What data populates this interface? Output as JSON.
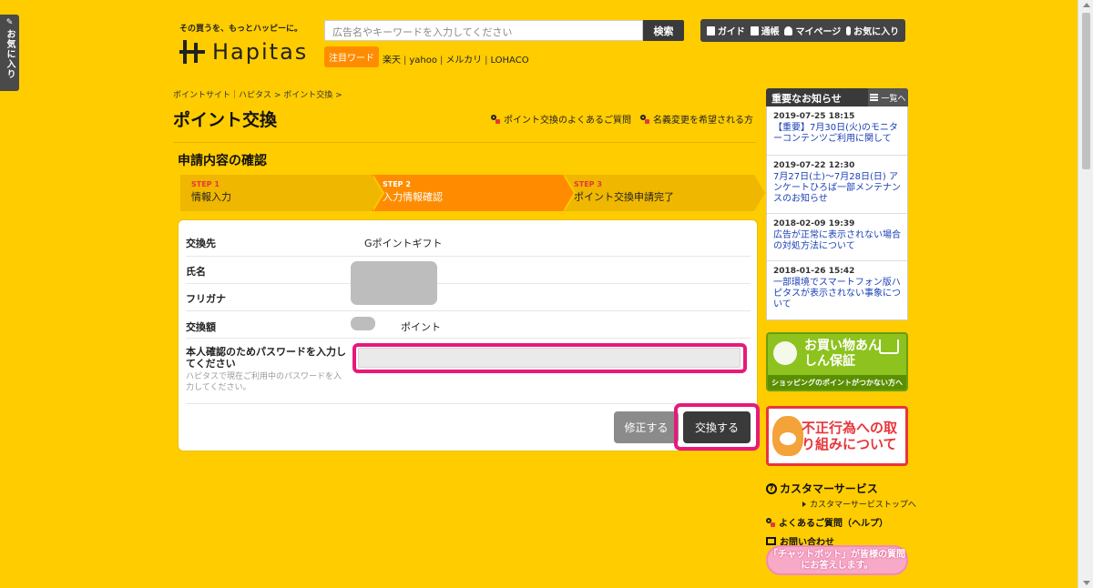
{
  "side_tab": {
    "label": "お気に入り"
  },
  "header": {
    "tagline": "その買うを、もっとハッピーに。",
    "logo_text": "Hapitas",
    "search": {
      "placeholder": "広告名やキーワードを入力してください",
      "button": "検索"
    },
    "hot_label": "注目ワード",
    "hot_links": [
      "楽天",
      "yahoo",
      "メルカリ",
      "LOHACO"
    ],
    "nav": [
      {
        "label": "ガイド",
        "icon": "book-icon"
      },
      {
        "label": "通帳",
        "icon": "passbook-icon"
      },
      {
        "label": "マイページ",
        "icon": "person-icon"
      },
      {
        "label": "お気に入り",
        "icon": "clip-icon"
      }
    ]
  },
  "breadcrumb": "ポイントサイト｜ハピタス > ポイント交換 >",
  "page_title": "ポイント交換",
  "help_links": [
    "ポイント交換のよくあるご質問",
    "名義変更を希望される方"
  ],
  "section_title": "申請内容の確認",
  "steps": [
    {
      "num": "STEP 1",
      "label": "情報入力"
    },
    {
      "num": "STEP 2",
      "label": "入力情報確認"
    },
    {
      "num": "STEP 3",
      "label": "ポイント交換申請完了"
    }
  ],
  "form": {
    "exchange_to_label": "交換先",
    "exchange_to_value": "Gポイントギフト",
    "name_label": "氏名",
    "furigana_label": "フリガナ",
    "amount_label": "交換額",
    "amount_unit": "ポイント",
    "password_label": "本人確認のためパスワードを入力してください",
    "password_note": "ハピタスで現在ご利用中のパスワードを入力してください。",
    "password_value": "",
    "edit_button": "修正する",
    "exchange_button": "交換する"
  },
  "sidebar": {
    "notice_title": "重要なお知らせ",
    "notice_more": "一覧へ",
    "notices": [
      {
        "date": "2019-07-25 18:15",
        "text": "【重要】7月30日(火)のモニターコンテンツご利用に関して"
      },
      {
        "date": "2019-07-22 12:30",
        "text": "7月27日(土)〜7月28日(日) アンケートひろば一部メンテナンスのお知らせ"
      },
      {
        "date": "2018-02-09 19:39",
        "text": "広告が正常に表示されない場合の対処方法について"
      },
      {
        "date": "2018-01-26 15:42",
        "text": "一部環境でスマートフォン版ハピタスが表示されない事象について"
      }
    ],
    "banner_green": {
      "title": "お買い物あんしん保証",
      "subtitle": "ショッピングのポイントがつかない方へ"
    },
    "banner_red": {
      "title": "不正行為への取り組みについて"
    },
    "cs_title": "カスタマーサービス",
    "cs_top": "カスタマーサービストップへ",
    "faq": "よくあるご質問（ヘルプ）",
    "contact": "お問い合わせ",
    "chatbot": "「チャットボット」が皆様の質問にお答えします。"
  },
  "colors": {
    "background": "#ffcc00",
    "accent": "#ff8c00",
    "highlight": "#e8197a",
    "link": "#1a3fb5"
  }
}
